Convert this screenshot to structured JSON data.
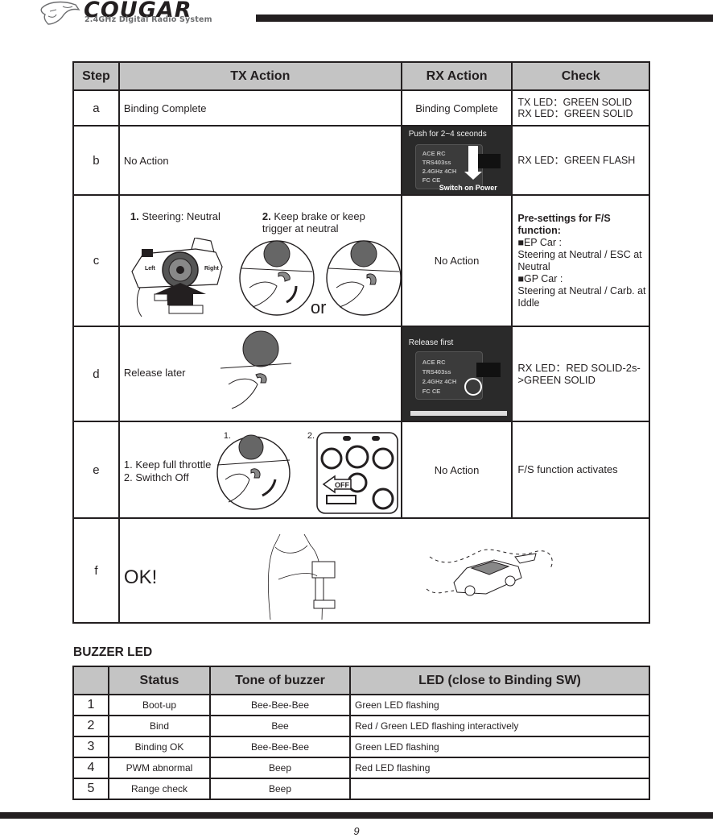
{
  "header": {
    "brand": "COUGAR",
    "subtitle": "2.4GHz Digital Radio System",
    "logo_icon": "cougar-head-icon"
  },
  "steps_table": {
    "headers": {
      "step": "Step",
      "tx": "TX Action",
      "rx": "RX Action",
      "check": "Check"
    },
    "rows": [
      {
        "step": "a",
        "tx": "Binding Complete",
        "rx": "Binding Complete",
        "check": [
          "TX LED：GREEN SOLID",
          "RX LED：GREEN SOLID"
        ]
      },
      {
        "step": "b",
        "tx": "No Action",
        "rx_image": {
          "caption": "Push for 2~4 sceonds",
          "brand": "ACE RC",
          "model": "TRS403ss",
          "band": "2.4GHz 4CH",
          "cert": "FC CE",
          "arrow_label": "PUSH",
          "footer": "Switch on Power"
        },
        "check": [
          "RX LED：GREEN FLASH"
        ]
      },
      {
        "step": "c",
        "tx_steps": [
          {
            "num": "1.",
            "text": "Steering: Neutral"
          },
          {
            "num": "2.",
            "text": "Keep brake or keep trigger at neutral"
          }
        ],
        "tx_labels": {
          "left": "Left",
          "right": "Right",
          "or": "or"
        },
        "rx": "No Action",
        "check": {
          "title": "Pre-settings for F/S function:",
          "items": [
            {
              "bullet": "■",
              "label": "EP Car :",
              "detail": "Steering at Neutral / ESC at Neutral"
            },
            {
              "bullet": "■",
              "label": "GP Car :",
              "detail": "Steering at Neutral / Carb. at Iddle"
            }
          ]
        }
      },
      {
        "step": "d",
        "tx": "Release later",
        "rx_image": {
          "caption": "Release first",
          "brand": "ACE RC",
          "model": "TRS403ss",
          "band": "2.4GHz 4CH",
          "cert": "FC CE"
        },
        "check": [
          "RX LED：RED SOLID-2s->GREEN SOLID"
        ]
      },
      {
        "step": "e",
        "tx_lines": [
          "1. Keep full throttle",
          "2. Swithch Off"
        ],
        "tx_fig_labels": [
          "1.",
          "2."
        ],
        "tx_off_label": "OFF",
        "rx": "No Action",
        "check": [
          "F/S function activates"
        ]
      },
      {
        "step": "f",
        "tx": "OK!"
      }
    ]
  },
  "buzzer": {
    "title": "BUZZER LED",
    "headers": [
      "",
      "Status",
      "Tone of buzzer",
      "LED (close to Binding SW)"
    ],
    "rows": [
      {
        "n": "1",
        "status": "Boot-up",
        "tone": "Bee-Bee-Bee",
        "led": "Green LED flashing"
      },
      {
        "n": "2",
        "status": "Bind",
        "tone": "Bee",
        "led": "Red / Green LED flashing interactively"
      },
      {
        "n": "3",
        "status": "Binding OK",
        "tone": "Bee-Bee-Bee",
        "led": "Green LED flashing"
      },
      {
        "n": "4",
        "status": "PWM abnormal",
        "tone": "Beep",
        "led": "Red LED flashing"
      },
      {
        "n": "5",
        "status": "Range check",
        "tone": "Beep",
        "led": ""
      }
    ]
  },
  "footer": {
    "page_number": "9"
  },
  "colors": {
    "ink": "#231f20",
    "header_fill": "#c4c4c4",
    "subtitle_gray": "#6d6e70"
  }
}
